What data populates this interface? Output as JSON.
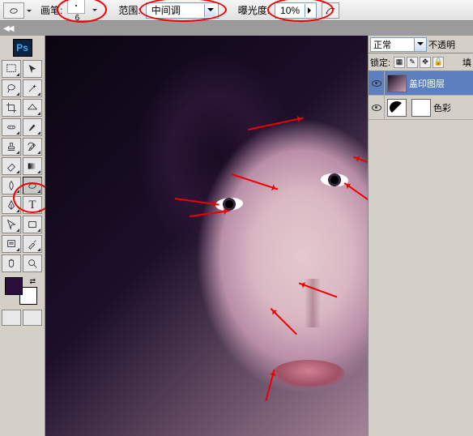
{
  "options_bar": {
    "brush_label": "画笔:",
    "brush_size": "6",
    "range_label": "范围:",
    "range_value": "中间调",
    "exposure_label": "曝光度:",
    "exposure_value": "10%"
  },
  "blend": {
    "mode": "正常",
    "opacity_label": "不透明"
  },
  "lock": {
    "label": "锁定:",
    "fill_label": "填"
  },
  "layers": [
    {
      "name": "盖印图层"
    },
    {
      "name": "色彩"
    }
  ],
  "tools": {
    "ps": "Ps"
  }
}
